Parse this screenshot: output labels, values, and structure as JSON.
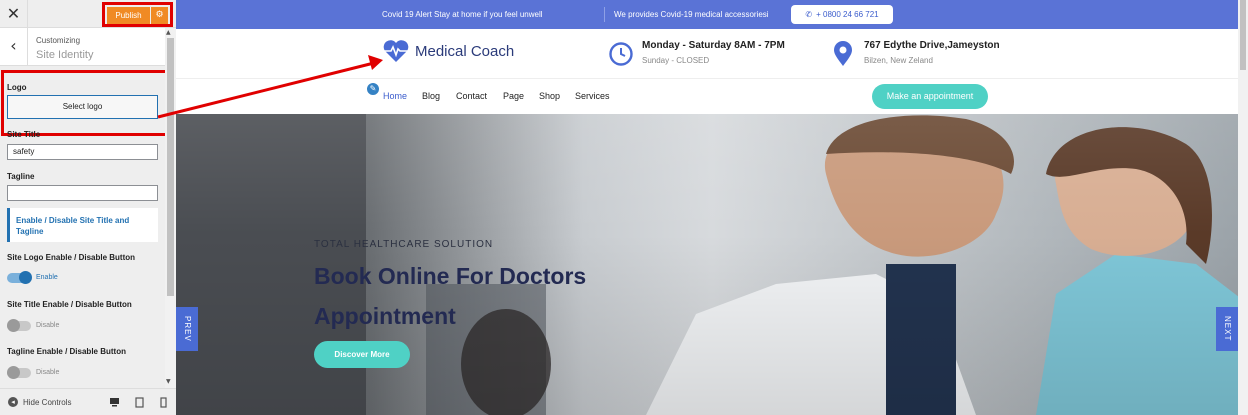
{
  "customizer": {
    "close_glyph": "✕",
    "publish_label": "Publish",
    "publish_gear_glyph": "⚙",
    "back_glyph": "‹",
    "customizing_label": "Customizing",
    "section_title": "Site Identity",
    "logo_label": "Logo",
    "select_logo_label": "Select logo",
    "site_title_label": "Site Title",
    "site_title_value": "safety",
    "tagline_label": "Tagline",
    "tagline_value": "",
    "toggle_group_label": "Enable / Disable Site Title and Tagline",
    "site_logo_toggle_label": "Site Logo Enable / Disable Button",
    "site_logo_toggle_state": "Enable",
    "site_title_toggle_label": "Site Title Enable / Disable Button",
    "site_title_toggle_state": "Disable",
    "tagline_toggle_label": "Tagline Enable / Disable Button",
    "tagline_toggle_state": "Disable",
    "hide_controls_label": "Hide Controls",
    "colors": {
      "publish": "#f08a24",
      "accent": "#2271b1",
      "highlight": "#e00000"
    }
  },
  "preview": {
    "topbar": {
      "alert": "Covid 19 Alert Stay at home if you feel unwell",
      "supplies": "We provides Covid-19 medical accessoriesi",
      "phone": "+ 0800 24 66 721",
      "color": "#5a73d6"
    },
    "header": {
      "site_name": "Medical Coach",
      "hours_title": "Monday - Saturday 8AM - 7PM",
      "hours_sub": "Sunday - CLOSED",
      "address_title": "767 Edythe Drive,Jameyston",
      "address_sub": "Bilzen, New Zeland"
    },
    "nav": {
      "items": [
        "Home",
        "Blog",
        "Contact",
        "Page",
        "Shop",
        "Services"
      ],
      "active": "Home",
      "cta": "Make an appointment",
      "cta_color": "#4fd1c5"
    },
    "hero": {
      "eyebrow": "TOTAL HEALTHCARE SOLUTION",
      "title": "Book Online For Doctors Appointment",
      "button": "Discover More",
      "prev": "PREV",
      "next": "NEXT"
    }
  }
}
